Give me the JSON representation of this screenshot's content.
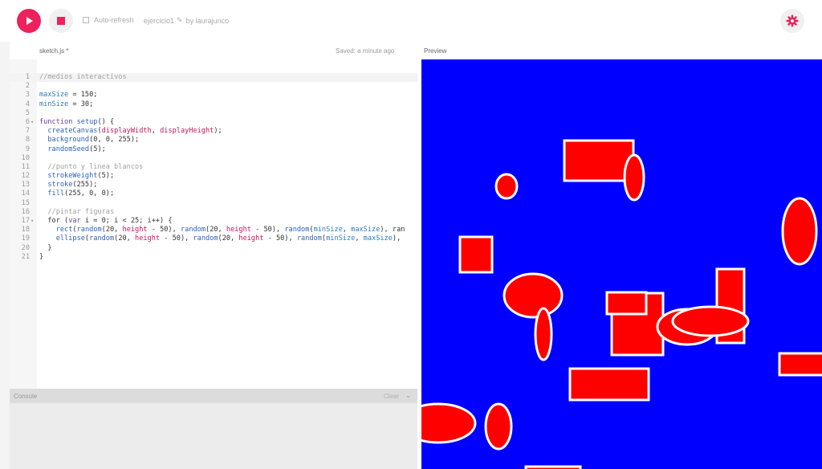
{
  "toolbar": {
    "play_icon": "play-icon",
    "stop_icon": "stop-icon",
    "auto_refresh_label": "Auto-refresh",
    "project_name": "ejercicio1",
    "author": "by laurajunco",
    "settings_icon": "gear-icon"
  },
  "editor": {
    "file_name": "sketch.js",
    "unsaved_marker": "*",
    "saved_status": "Saved: a minute ago",
    "lines": [
      {
        "n": "1",
        "fold": "",
        "text": "//medios interactivos",
        "active": true
      },
      {
        "n": "2",
        "fold": "",
        "text": ""
      },
      {
        "n": "3",
        "fold": "",
        "text": "maxSize = 150;"
      },
      {
        "n": "4",
        "fold": "",
        "text": "minSize = 30;"
      },
      {
        "n": "5",
        "fold": "",
        "text": ""
      },
      {
        "n": "6",
        "fold": "▾",
        "text": "function setup() {"
      },
      {
        "n": "7",
        "fold": "",
        "text": "  createCanvas(displayWidth, displayHeight);"
      },
      {
        "n": "8",
        "fold": "",
        "text": "  background(0, 0, 255);"
      },
      {
        "n": "9",
        "fold": "",
        "text": "  randomSeed(5);"
      },
      {
        "n": "10",
        "fold": "",
        "text": ""
      },
      {
        "n": "11",
        "fold": "",
        "text": "  //punto y linea blancos"
      },
      {
        "n": "12",
        "fold": "",
        "text": "  strokeWeight(5);"
      },
      {
        "n": "13",
        "fold": "",
        "text": "  stroke(255);"
      },
      {
        "n": "14",
        "fold": "",
        "text": "  fill(255, 0, 0);"
      },
      {
        "n": "15",
        "fold": "",
        "text": ""
      },
      {
        "n": "16",
        "fold": "",
        "text": "  //pintar figuras"
      },
      {
        "n": "17",
        "fold": "▾",
        "text": "  for (var i = 0; i < 25; i++) {"
      },
      {
        "n": "18",
        "fold": "",
        "text": "    rect(random(20, height - 50), random(20, height - 50), random(minSize, maxSize), ran"
      },
      {
        "n": "19",
        "fold": "",
        "text": "    ellipse(random(20, height - 50), random(20, height - 50), random(minSize, maxSize),"
      },
      {
        "n": "20",
        "fold": "",
        "text": "  }"
      },
      {
        "n": "21",
        "fold": "",
        "text": "}"
      }
    ]
  },
  "console": {
    "label": "Console",
    "clear_label": "Clear"
  },
  "preview": {
    "label": "Preview",
    "colors": {
      "background": "#0000ff",
      "fill": "#ff0000",
      "stroke": "#ffffff"
    }
  },
  "colors": {
    "accent": "#ed225d"
  }
}
